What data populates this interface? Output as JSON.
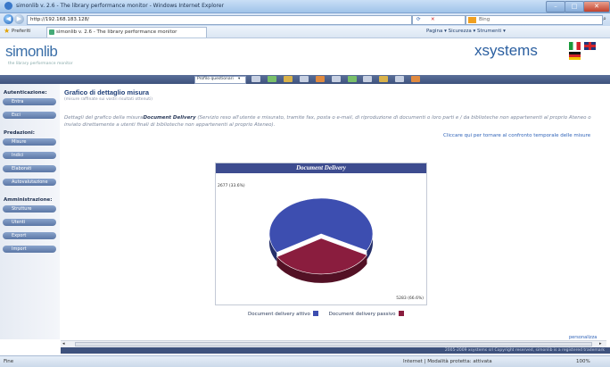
{
  "browser": {
    "title": "simonlib v. 2.6 - The library performance monitor - Windows Internet Explorer",
    "url": "http://192.168.183.128/",
    "search_placeholder": "Bing",
    "favorites_label": "Preferiti",
    "tab_label": "simonlib v. 2.6 - The library performance monitor",
    "command_bar": "Pagina ▾  Sicurezza ▾  Strumenti ▾",
    "status_left": "Fine",
    "status_zone": "Internet | Modalità protetta: attivata",
    "status_zoom": "100%"
  },
  "header": {
    "logo": "simonlib",
    "logo_sub": "the library performance monitor",
    "brand": "xsystems"
  },
  "toolbar": {
    "profile_select": "Profilo questionari"
  },
  "sidebar": {
    "sections": [
      {
        "title": "Autenticazione:",
        "items": [
          "Entra",
          "Esci"
        ]
      },
      {
        "title": "Predazioni:",
        "items": [
          "Misure",
          "Indici",
          "Elaborati",
          "Autovalutazione"
        ]
      },
      {
        "title": "Amministrazione:",
        "items": [
          "Strutture",
          "Utenti",
          "Export",
          "Import"
        ]
      }
    ]
  },
  "main": {
    "title": "Grafico di dettaglio misura",
    "subtitle": "(misure raffinate sui vostri risultati ottenuti)",
    "details_prefix": "Dettagli del grafico della misura",
    "details_measure": "Document Delivery",
    "details_rest": "(Servizio reso all'utente e misurato, tramite fax, posta o e-mail, di riproduzione di documenti o loro parti e / da biblioteche non appartenenti al proprio Ateneo o inviato direttamente a utenti finali di biblioteche non appartenenti al proprio Ateneo).",
    "back_link": "Cliccare qui per tornare al confronto temporale delle misure",
    "personalizza": "personalizza"
  },
  "chart_data": {
    "type": "pie",
    "title": "Document Delivery",
    "slices": [
      {
        "name": "Document delivery attivo",
        "value": 5283,
        "label": "5283 (66.6%)",
        "color": "#3d4eb0"
      },
      {
        "name": "Document delivery passivo",
        "value": 2677,
        "label": "2677 (33.6%)",
        "color": "#8a1d3e"
      }
    ],
    "legend_position": "bottom"
  },
  "footer": {
    "copyright": "2005-2009 xsystems srl Copyright reserved, simonlib is a registered trademark"
  }
}
